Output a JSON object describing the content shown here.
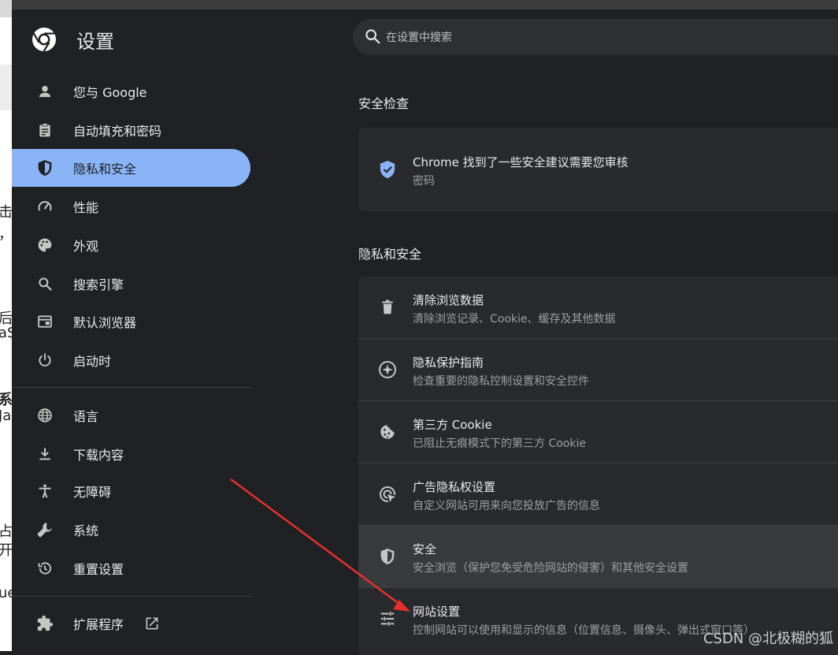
{
  "background_window": {
    "fragments": [
      "击",
      "，",
      "后",
      "aS",
      "系",
      "Ja",
      "占",
      "开",
      "ue"
    ]
  },
  "app": {
    "title": "设置",
    "logo": "chrome-logo-icon"
  },
  "search": {
    "placeholder": "在设置中搜索",
    "icon": "search-icon"
  },
  "sidebar": {
    "group1": [
      {
        "label": "您与 Google",
        "icon": "person-icon"
      },
      {
        "label": "自动填充和密码",
        "icon": "clipboard-icon"
      },
      {
        "label": "隐私和安全",
        "icon": "shield-icon",
        "active": true
      },
      {
        "label": "性能",
        "icon": "speedometer-icon"
      },
      {
        "label": "外观",
        "icon": "palette-icon"
      },
      {
        "label": "搜索引擎",
        "icon": "search-icon"
      },
      {
        "label": "默认浏览器",
        "icon": "browser-window-icon"
      },
      {
        "label": "启动时",
        "icon": "power-icon"
      }
    ],
    "group2": [
      {
        "label": "语言",
        "icon": "globe-icon"
      },
      {
        "label": "下载内容",
        "icon": "download-icon"
      },
      {
        "label": "无障碍",
        "icon": "accessibility-icon"
      },
      {
        "label": "系统",
        "icon": "wrench-icon"
      },
      {
        "label": "重置设置",
        "icon": "history-icon"
      }
    ],
    "extensions": {
      "label": "扩展程序",
      "icon": "puzzle-icon",
      "link_icon": "open-in-new-icon"
    }
  },
  "safety_check": {
    "heading": "安全检查",
    "title": "Chrome 找到了一些安全建议需要您审核",
    "subtitle": "密码",
    "icon": "shield-check-icon"
  },
  "privacy": {
    "heading": "隐私和安全",
    "rows": [
      {
        "title": "清除浏览数据",
        "subtitle": "清除浏览记录、Cookie、缓存及其他数据",
        "icon": "trash-icon"
      },
      {
        "title": "隐私保护指南",
        "subtitle": "检查重要的隐私控制设置和安全控件",
        "icon": "compass-icon"
      },
      {
        "title": "第三方 Cookie",
        "subtitle": "已阻止无痕模式下的第三方 Cookie",
        "icon": "cookie-icon"
      },
      {
        "title": "广告隐私权设置",
        "subtitle": "自定义网站可用来向您投放广告的信息",
        "icon": "ads-privacy-icon"
      },
      {
        "title": "安全",
        "subtitle": "安全浏览（保护您免受危险网站的侵害）和其他安全设置",
        "icon": "shield-icon",
        "highlight": true
      },
      {
        "title": "网站设置",
        "subtitle": "控制网站可以使用和显示的信息（位置信息、摄像头、弹出式窗口等）",
        "icon": "sliders-icon"
      }
    ]
  },
  "watermark": "CSDN @北极糊的狐",
  "colors": {
    "accent": "#8ab4f8",
    "background": "#202124",
    "card": "#292a2d",
    "arrow": "#e8312a"
  }
}
